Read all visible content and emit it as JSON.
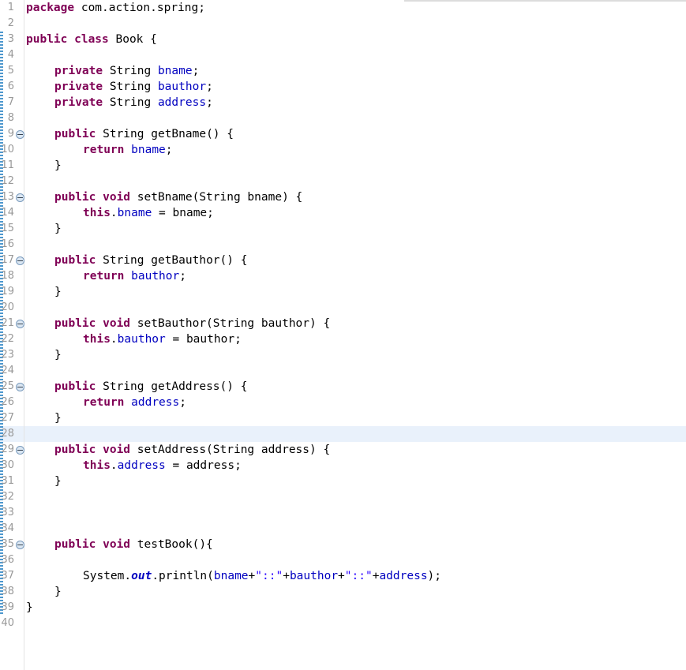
{
  "editor": {
    "app": "eclipse-java-editor",
    "file_class": "Book",
    "package": "com.action.spring",
    "current_line": 28,
    "total_lines": 40,
    "line_height_px": 20,
    "colors": {
      "background": "#ffffff",
      "keyword": "#7f0055",
      "field": "#0000c0",
      "string": "#2a00ff",
      "plain_text": "#000000",
      "line_number": "#999999",
      "current_line_highlight": "#e9f1fb",
      "gutter_rule": "#e4e4e4",
      "fold_marker_fill": "#dbe7f3",
      "fold_marker_border": "#7a9bbd",
      "change_bar": "#2f86c5",
      "top_rule": "#dcdcdc"
    }
  },
  "gutter": {
    "line_numbers": [
      "1",
      "2",
      "3",
      "4",
      "5",
      "6",
      "7",
      "8",
      "9",
      "10",
      "11",
      "12",
      "13",
      "14",
      "15",
      "16",
      "17",
      "18",
      "19",
      "20",
      "21",
      "22",
      "23",
      "24",
      "25",
      "26",
      "27",
      "28",
      "29",
      "30",
      "31",
      "32",
      "33",
      "34",
      "35",
      "36",
      "37",
      "38",
      "39",
      "40"
    ],
    "fold_marker_lines": [
      9,
      13,
      17,
      21,
      25,
      29,
      35
    ],
    "fold_marker_glyph": "minus-circle"
  },
  "code": {
    "lines": [
      {
        "n": 1,
        "indent": 0,
        "tokens": [
          {
            "t": "package",
            "c": "kw"
          },
          {
            "t": " com.action.spring;",
            "c": "plain"
          }
        ]
      },
      {
        "n": 2,
        "indent": 0,
        "tokens": []
      },
      {
        "n": 3,
        "indent": 0,
        "tokens": [
          {
            "t": "public class",
            "c": "kw"
          },
          {
            "t": " Book {",
            "c": "plain"
          }
        ]
      },
      {
        "n": 4,
        "indent": 0,
        "tokens": []
      },
      {
        "n": 5,
        "indent": 1,
        "tokens": [
          {
            "t": "private",
            "c": "kw"
          },
          {
            "t": " String ",
            "c": "plain"
          },
          {
            "t": "bname",
            "c": "fld"
          },
          {
            "t": ";",
            "c": "plain"
          }
        ]
      },
      {
        "n": 6,
        "indent": 1,
        "tokens": [
          {
            "t": "private",
            "c": "kw"
          },
          {
            "t": " String ",
            "c": "plain"
          },
          {
            "t": "bauthor",
            "c": "fld"
          },
          {
            "t": ";",
            "c": "plain"
          }
        ]
      },
      {
        "n": 7,
        "indent": 1,
        "tokens": [
          {
            "t": "private",
            "c": "kw"
          },
          {
            "t": " String ",
            "c": "plain"
          },
          {
            "t": "address",
            "c": "fld"
          },
          {
            "t": ";",
            "c": "plain"
          }
        ]
      },
      {
        "n": 8,
        "indent": 0,
        "tokens": []
      },
      {
        "n": 9,
        "indent": 1,
        "tokens": [
          {
            "t": "public",
            "c": "kw"
          },
          {
            "t": " String getBname() {",
            "c": "plain"
          }
        ]
      },
      {
        "n": 10,
        "indent": 2,
        "tokens": [
          {
            "t": "return",
            "c": "kw"
          },
          {
            "t": " ",
            "c": "plain"
          },
          {
            "t": "bname",
            "c": "fld"
          },
          {
            "t": ";",
            "c": "plain"
          }
        ]
      },
      {
        "n": 11,
        "indent": 1,
        "tokens": [
          {
            "t": "}",
            "c": "plain"
          }
        ]
      },
      {
        "n": 12,
        "indent": 0,
        "tokens": []
      },
      {
        "n": 13,
        "indent": 1,
        "tokens": [
          {
            "t": "public void",
            "c": "kw"
          },
          {
            "t": " setBname(String bname) {",
            "c": "plain"
          }
        ]
      },
      {
        "n": 14,
        "indent": 2,
        "tokens": [
          {
            "t": "this",
            "c": "kw"
          },
          {
            "t": ".",
            "c": "plain"
          },
          {
            "t": "bname",
            "c": "fld"
          },
          {
            "t": " = bname;",
            "c": "plain"
          }
        ]
      },
      {
        "n": 15,
        "indent": 1,
        "tokens": [
          {
            "t": "}",
            "c": "plain"
          }
        ]
      },
      {
        "n": 16,
        "indent": 0,
        "tokens": []
      },
      {
        "n": 17,
        "indent": 1,
        "tokens": [
          {
            "t": "public",
            "c": "kw"
          },
          {
            "t": " String getBauthor() {",
            "c": "plain"
          }
        ]
      },
      {
        "n": 18,
        "indent": 2,
        "tokens": [
          {
            "t": "return",
            "c": "kw"
          },
          {
            "t": " ",
            "c": "plain"
          },
          {
            "t": "bauthor",
            "c": "fld"
          },
          {
            "t": ";",
            "c": "plain"
          }
        ]
      },
      {
        "n": 19,
        "indent": 1,
        "tokens": [
          {
            "t": "}",
            "c": "plain"
          }
        ]
      },
      {
        "n": 20,
        "indent": 0,
        "tokens": []
      },
      {
        "n": 21,
        "indent": 1,
        "tokens": [
          {
            "t": "public void",
            "c": "kw"
          },
          {
            "t": " setBauthor(String bauthor) {",
            "c": "plain"
          }
        ]
      },
      {
        "n": 22,
        "indent": 2,
        "tokens": [
          {
            "t": "this",
            "c": "kw"
          },
          {
            "t": ".",
            "c": "plain"
          },
          {
            "t": "bauthor",
            "c": "fld"
          },
          {
            "t": " = bauthor;",
            "c": "plain"
          }
        ]
      },
      {
        "n": 23,
        "indent": 1,
        "tokens": [
          {
            "t": "}",
            "c": "plain"
          }
        ]
      },
      {
        "n": 24,
        "indent": 0,
        "tokens": []
      },
      {
        "n": 25,
        "indent": 1,
        "tokens": [
          {
            "t": "public",
            "c": "kw"
          },
          {
            "t": " String getAddress() {",
            "c": "plain"
          }
        ]
      },
      {
        "n": 26,
        "indent": 2,
        "tokens": [
          {
            "t": "return",
            "c": "kw"
          },
          {
            "t": " ",
            "c": "plain"
          },
          {
            "t": "address",
            "c": "fld"
          },
          {
            "t": ";",
            "c": "plain"
          }
        ]
      },
      {
        "n": 27,
        "indent": 1,
        "tokens": [
          {
            "t": "}",
            "c": "plain"
          }
        ]
      },
      {
        "n": 28,
        "indent": 0,
        "tokens": []
      },
      {
        "n": 29,
        "indent": 1,
        "tokens": [
          {
            "t": "public void",
            "c": "kw"
          },
          {
            "t": " setAddress(String address) {",
            "c": "plain"
          }
        ]
      },
      {
        "n": 30,
        "indent": 2,
        "tokens": [
          {
            "t": "this",
            "c": "kw"
          },
          {
            "t": ".",
            "c": "plain"
          },
          {
            "t": "address",
            "c": "fld"
          },
          {
            "t": " = address;",
            "c": "plain"
          }
        ]
      },
      {
        "n": 31,
        "indent": 1,
        "tokens": [
          {
            "t": "}",
            "c": "plain"
          }
        ]
      },
      {
        "n": 32,
        "indent": 0,
        "tokens": []
      },
      {
        "n": 33,
        "indent": 0,
        "tokens": []
      },
      {
        "n": 34,
        "indent": 0,
        "tokens": []
      },
      {
        "n": 35,
        "indent": 1,
        "tokens": [
          {
            "t": "public void",
            "c": "kw"
          },
          {
            "t": " testBook(){",
            "c": "plain"
          }
        ]
      },
      {
        "n": 36,
        "indent": 0,
        "tokens": []
      },
      {
        "n": 37,
        "indent": 2,
        "tokens": [
          {
            "t": "System.",
            "c": "plain"
          },
          {
            "t": "out",
            "c": "sfld"
          },
          {
            "t": ".println(",
            "c": "plain"
          },
          {
            "t": "bname",
            "c": "fld"
          },
          {
            "t": "+",
            "c": "plain"
          },
          {
            "t": "\"::\"",
            "c": "str"
          },
          {
            "t": "+",
            "c": "plain"
          },
          {
            "t": "bauthor",
            "c": "fld"
          },
          {
            "t": "+",
            "c": "plain"
          },
          {
            "t": "\"::\"",
            "c": "str"
          },
          {
            "t": "+",
            "c": "plain"
          },
          {
            "t": "address",
            "c": "fld"
          },
          {
            "t": ");",
            "c": "plain"
          }
        ]
      },
      {
        "n": 38,
        "indent": 1,
        "tokens": [
          {
            "t": "}",
            "c": "plain"
          }
        ]
      },
      {
        "n": 39,
        "indent": 0,
        "tokens": [
          {
            "t": "}",
            "c": "plain"
          }
        ]
      },
      {
        "n": 40,
        "indent": 0,
        "tokens": []
      }
    ]
  }
}
